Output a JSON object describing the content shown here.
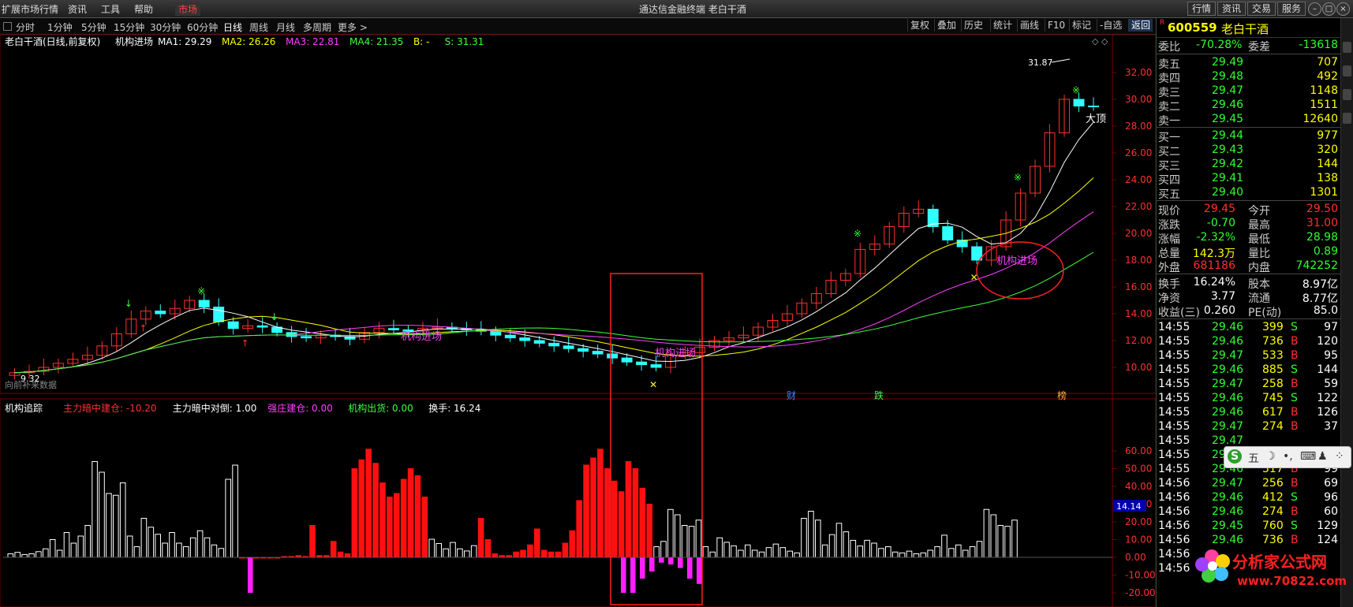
{
  "menubar": {
    "items": [
      "扩展市场行情",
      "资讯",
      "工具",
      "帮助",
      "市场"
    ],
    "window_title": "通达信金融终端  老白干酒",
    "right_buttons": [
      "行情",
      "资讯",
      "交易",
      "服务"
    ]
  },
  "periodbar": {
    "periods": [
      "分时",
      "1分钟",
      "5分钟",
      "15分钟",
      "30分钟",
      "60分钟",
      "日线",
      "周线",
      "月线",
      "多周期",
      "更多 >"
    ],
    "active_index": 6,
    "tools": [
      "复权",
      "叠加",
      "历史",
      "统计",
      "画线",
      "F10",
      "标记",
      "-自选",
      "返回"
    ]
  },
  "main_chart": {
    "title": "老白干酒(日线,前复权)",
    "indicator_name": "机构进场",
    "ma_labels": [
      {
        "text": "MA1: 29.29",
        "color": "#ffffff"
      },
      {
        "text": "MA2: 26.26",
        "color": "#ffff00"
      },
      {
        "text": "MA3: 22.81",
        "color": "#ff40ff"
      },
      {
        "text": "MA4: 21.35",
        "color": "#40ff40"
      },
      {
        "text": "B: -",
        "color": "#ffff00"
      },
      {
        "text": "S: 31.31",
        "color": "#40ff40"
      }
    ],
    "price_axis": [
      "32.00",
      "30.00",
      "28.00",
      "26.00",
      "24.00",
      "22.00",
      "20.00",
      "18.00",
      "16.00",
      "14.00",
      "12.00",
      "10.00"
    ],
    "high_label": "31.87",
    "low_label": "9.32",
    "top_label": "大顶",
    "signal_labels": [
      "机构进场",
      "机构进场",
      "机构进场"
    ],
    "event_tags": [
      "财",
      "跌",
      "榜"
    ],
    "history_note": "向前补来数据"
  },
  "sub_chart": {
    "indicator_name": "机构追踪",
    "labels": [
      {
        "text": "主力暗中建仓: -10.20",
        "color": "#ff3030"
      },
      {
        "text": "主力暗中对倒: 1.00",
        "color": "#ffffff"
      },
      {
        "text": "强庄建仓: 0.00",
        "color": "#ff40ff"
      },
      {
        "text": "机构出货: 0.00",
        "color": "#40ff40"
      },
      {
        "text": "换手: 16.24",
        "color": "#ffffff"
      }
    ],
    "axis": [
      "60.00",
      "50.00",
      "40.00",
      "30.00",
      "20.00",
      "10.00",
      "0.00",
      "-10.00",
      "-20.00"
    ],
    "current_value": "14.14"
  },
  "chart_data": [
    {
      "type": "candlestick",
      "title": "老白干酒(日线,前复权)",
      "ylim": [
        9,
        33
      ],
      "ma": {
        "MA1": 29.29,
        "MA2": 26.26,
        "MA3": 22.81,
        "MA4": 21.35
      },
      "marked_high": 31.87,
      "marked_low": 9.32,
      "close_key": [
        9.6,
        9.7,
        10.0,
        10.3,
        10.6,
        10.9,
        11.6,
        12.5,
        13.6,
        14.2,
        14.0,
        14.4,
        15.0,
        14.5,
        13.4,
        12.9,
        13.1,
        13.0,
        12.6,
        12.3,
        12.2,
        12.4,
        12.3,
        12.1,
        12.6,
        12.9,
        12.8,
        12.7,
        12.9,
        13.0,
        12.9,
        12.8,
        12.7,
        12.4,
        12.2,
        12.0,
        11.8,
        11.6,
        11.4,
        11.2,
        11.0,
        10.7,
        10.4,
        10.2,
        10.0,
        10.9,
        11.1,
        11.5,
        12.0,
        12.2,
        12.4,
        13.0,
        13.5,
        14.0,
        14.8,
        15.5,
        16.5,
        17.0,
        18.8,
        19.2,
        20.5,
        21.5,
        21.8,
        20.5,
        19.5,
        19.0,
        18.0,
        19.0,
        21.0,
        23.0,
        25.0,
        27.5,
        30.0,
        29.5,
        29.45
      ]
    },
    {
      "type": "bar",
      "title": "机构追踪",
      "ylim": [
        -20,
        65
      ],
      "series": [
        {
          "name": "主力暗中建仓",
          "color": "#ff1010",
          "values": [
            0,
            0,
            0,
            0,
            0,
            0,
            1,
            1,
            2,
            1,
            18,
            1,
            1,
            9,
            3,
            2,
            50,
            55,
            61,
            53,
            42,
            34,
            36,
            44,
            50,
            46,
            34,
            22,
            10,
            2,
            1,
            1,
            3,
            4,
            7,
            16,
            4,
            3,
            3,
            8,
            15,
            32,
            52,
            56,
            61,
            50,
            43,
            37,
            54,
            50,
            39,
            30
          ]
        },
        {
          "name": "主力暗中对倒",
          "color": "#ffffff",
          "values": [
            5,
            7,
            4,
            5,
            8,
            12,
            25,
            10,
            14,
            8,
            12,
            18,
            54,
            48,
            36,
            35,
            42,
            12,
            6,
            22,
            17,
            13,
            8,
            14,
            8,
            6,
            11,
            15,
            11,
            7,
            5,
            44,
            52,
            42,
            14,
            8,
            12,
            9,
            6,
            4,
            6,
            5,
            10,
            12,
            6
          ]
        },
        {
          "name": "强庄建仓",
          "color": "#ff20ff",
          "values": [
            -20,
            -20,
            -12,
            -8,
            -3,
            -4,
            -6,
            -12,
            -15
          ]
        }
      ]
    }
  ],
  "side_panel": {
    "badge": "R",
    "code": "600559",
    "name": "老白干酒",
    "weibi": {
      "label1": "委比",
      "val1": "-70.28%",
      "label2": "委差",
      "val2": "-13618"
    },
    "asks": [
      {
        "label": "卖五",
        "price": "29.49",
        "vol": "707"
      },
      {
        "label": "卖四",
        "price": "29.48",
        "vol": "492"
      },
      {
        "label": "卖三",
        "price": "29.47",
        "vol": "1148"
      },
      {
        "label": "卖二",
        "price": "29.46",
        "vol": "1511"
      },
      {
        "label": "卖一",
        "price": "29.45",
        "vol": "12640"
      }
    ],
    "bids": [
      {
        "label": "买一",
        "price": "29.44",
        "vol": "977"
      },
      {
        "label": "买二",
        "price": "29.43",
        "vol": "320"
      },
      {
        "label": "买三",
        "price": "29.42",
        "vol": "144"
      },
      {
        "label": "买四",
        "price": "29.41",
        "vol": "138"
      },
      {
        "label": "买五",
        "price": "29.40",
        "vol": "1301"
      }
    ],
    "quote": [
      {
        "l1": "现价",
        "v1": "29.45",
        "c1": "#ff3030",
        "l2": "今开",
        "v2": "29.50",
        "c2": "#ff3030"
      },
      {
        "l1": "涨跌",
        "v1": "-0.70",
        "c1": "#30ff30",
        "l2": "最高",
        "v2": "31.00",
        "c2": "#ff3030"
      },
      {
        "l1": "涨幅",
        "v1": "-2.32%",
        "c1": "#30ff30",
        "l2": "最低",
        "v2": "28.98",
        "c2": "#30ff30"
      },
      {
        "l1": "总量",
        "v1": "142.3万",
        "c1": "#ffff00",
        "l2": "量比",
        "v2": "0.89",
        "c2": "#30ff30"
      },
      {
        "l1": "外盘",
        "v1": "681186",
        "c1": "#ff3030",
        "l2": "内盘",
        "v2": "742252",
        "c2": "#30ff30"
      }
    ],
    "stats": [
      {
        "l1": "换手",
        "v1": "16.24%",
        "l2": "股本",
        "v2": "8.97亿"
      },
      {
        "l1": "净资",
        "v1": "3.77",
        "l2": "流通",
        "v2": "8.77亿"
      },
      {
        "l1": "收益(三)",
        "v1": "0.260",
        "l2": "PE(动)",
        "v2": "85.0"
      }
    ],
    "ticks": [
      {
        "time": "14:55",
        "price": "29.46",
        "vol": "399",
        "side": "S",
        "num": "97"
      },
      {
        "time": "14:55",
        "price": "29.46",
        "vol": "736",
        "side": "B",
        "num": "120"
      },
      {
        "time": "14:55",
        "price": "29.47",
        "vol": "533",
        "side": "B",
        "num": "95"
      },
      {
        "time": "14:55",
        "price": "29.46",
        "vol": "885",
        "side": "S",
        "num": "144"
      },
      {
        "time": "14:55",
        "price": "29.47",
        "vol": "258",
        "side": "B",
        "num": "59"
      },
      {
        "time": "14:55",
        "price": "29.46",
        "vol": "745",
        "side": "S",
        "num": "122"
      },
      {
        "time": "14:55",
        "price": "29.46",
        "vol": "617",
        "side": "B",
        "num": "126"
      },
      {
        "time": "14:55",
        "price": "29.47",
        "vol": "274",
        "side": "B",
        "num": "37"
      },
      {
        "time": "14:55",
        "price": "29.47",
        "vol": "",
        "side": "",
        "num": ""
      },
      {
        "time": "14:55",
        "price": "29.46",
        "vol": "665",
        "side": "S",
        "num": "69"
      },
      {
        "time": "14:55",
        "price": "29.46",
        "vol": "317",
        "side": "B",
        "num": "99"
      },
      {
        "time": "14:56",
        "price": "29.47",
        "vol": "256",
        "side": "B",
        "num": "69"
      },
      {
        "time": "14:56",
        "price": "29.46",
        "vol": "412",
        "side": "S",
        "num": "96"
      },
      {
        "time": "14:56",
        "price": "29.46",
        "vol": "274",
        "side": "B",
        "num": "60"
      },
      {
        "time": "14:56",
        "price": "29.45",
        "vol": "760",
        "side": "S",
        "num": "129"
      },
      {
        "time": "14:56",
        "price": "29.46",
        "vol": "736",
        "side": "B",
        "num": "124"
      },
      {
        "time": "14:56",
        "price": "",
        "vol": "",
        "side": "",
        "num": ""
      },
      {
        "time": "14:56",
        "price": "",
        "vol": "",
        "side": "",
        "num": ""
      }
    ]
  },
  "ime": {
    "label": "五"
  },
  "watermark": {
    "text": "分析家公式网",
    "url": "www.70822.com"
  },
  "colors": {
    "up": "#ff3030",
    "down": "#30ffff",
    "grid": "#7a0000",
    "box": "#ff2020"
  }
}
